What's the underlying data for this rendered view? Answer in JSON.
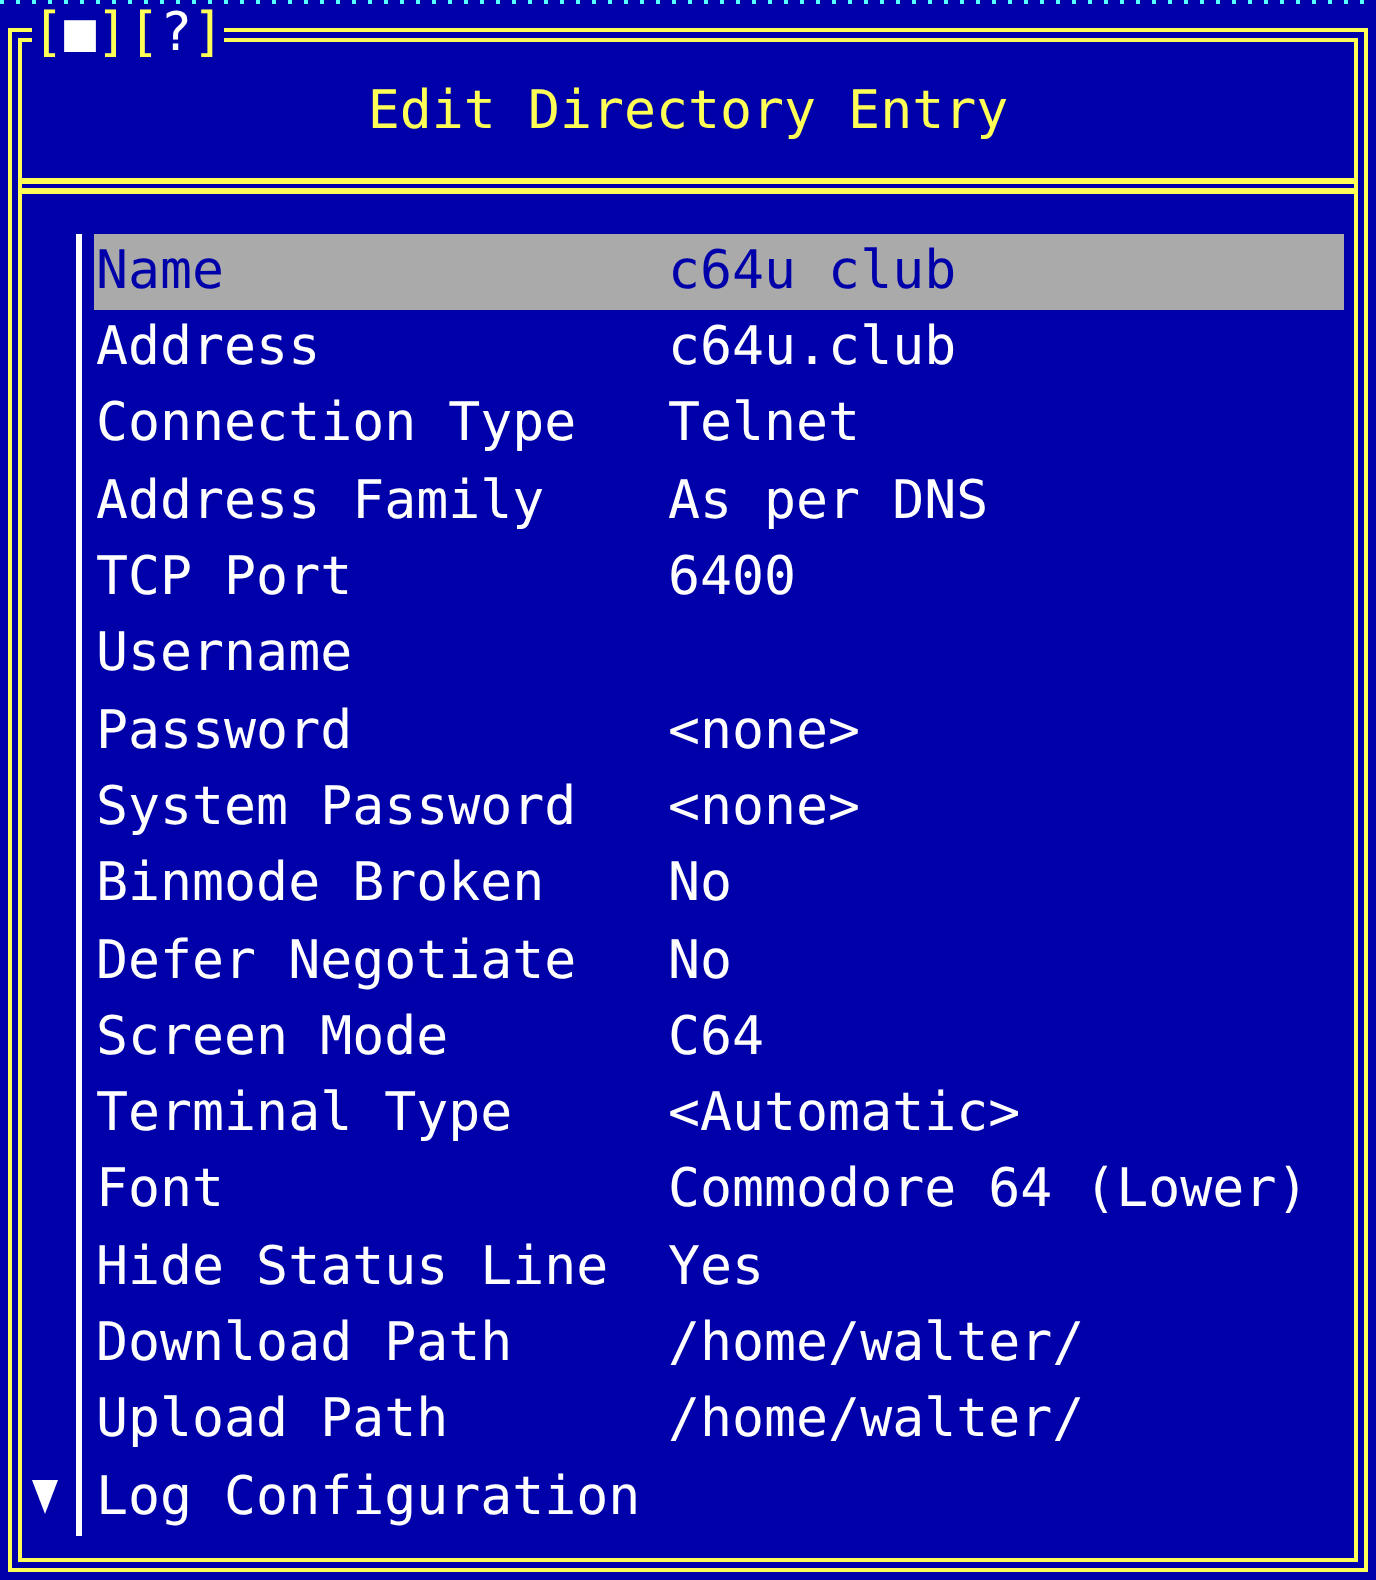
{
  "window": {
    "title": "Edit Directory Entry",
    "title_buttons": [
      {
        "left": "[",
        "glyph": "■",
        "right": "]"
      },
      {
        "left": "[",
        "glyph": "?",
        "right": "]"
      }
    ]
  },
  "items": [
    {
      "label": "Name",
      "value": "c64u club",
      "selected": true
    },
    {
      "label": "Address",
      "value": "c64u.club",
      "selected": false
    },
    {
      "label": "Connection Type",
      "value": "Telnet",
      "selected": false
    },
    {
      "label": "Address Family",
      "value": "As per DNS",
      "selected": false
    },
    {
      "label": "TCP Port",
      "value": "6400",
      "selected": false
    },
    {
      "label": "Username",
      "selected": false
    },
    {
      "label": "Password",
      "value": "<none>",
      "selected": false
    },
    {
      "label": "System Password",
      "value": "<none>",
      "selected": false
    },
    {
      "label": "Binmode Broken",
      "value": "No",
      "selected": false
    },
    {
      "label": "Defer Negotiate",
      "value": "No",
      "selected": false
    },
    {
      "label": "Screen Mode",
      "value": "C64",
      "selected": false
    },
    {
      "label": "Terminal Type",
      "value": "<Automatic>",
      "selected": false
    },
    {
      "label": "Font",
      "value": "Commodore 64 (Lower)",
      "selected": false
    },
    {
      "label": "Hide Status Line",
      "value": "Yes",
      "selected": false
    },
    {
      "label": "Download Path",
      "value": "/home/walter/",
      "selected": false
    },
    {
      "label": "Upload Path",
      "value": "/home/walter/",
      "selected": false
    },
    {
      "label": "Log Configuration",
      "selected": false
    }
  ]
}
